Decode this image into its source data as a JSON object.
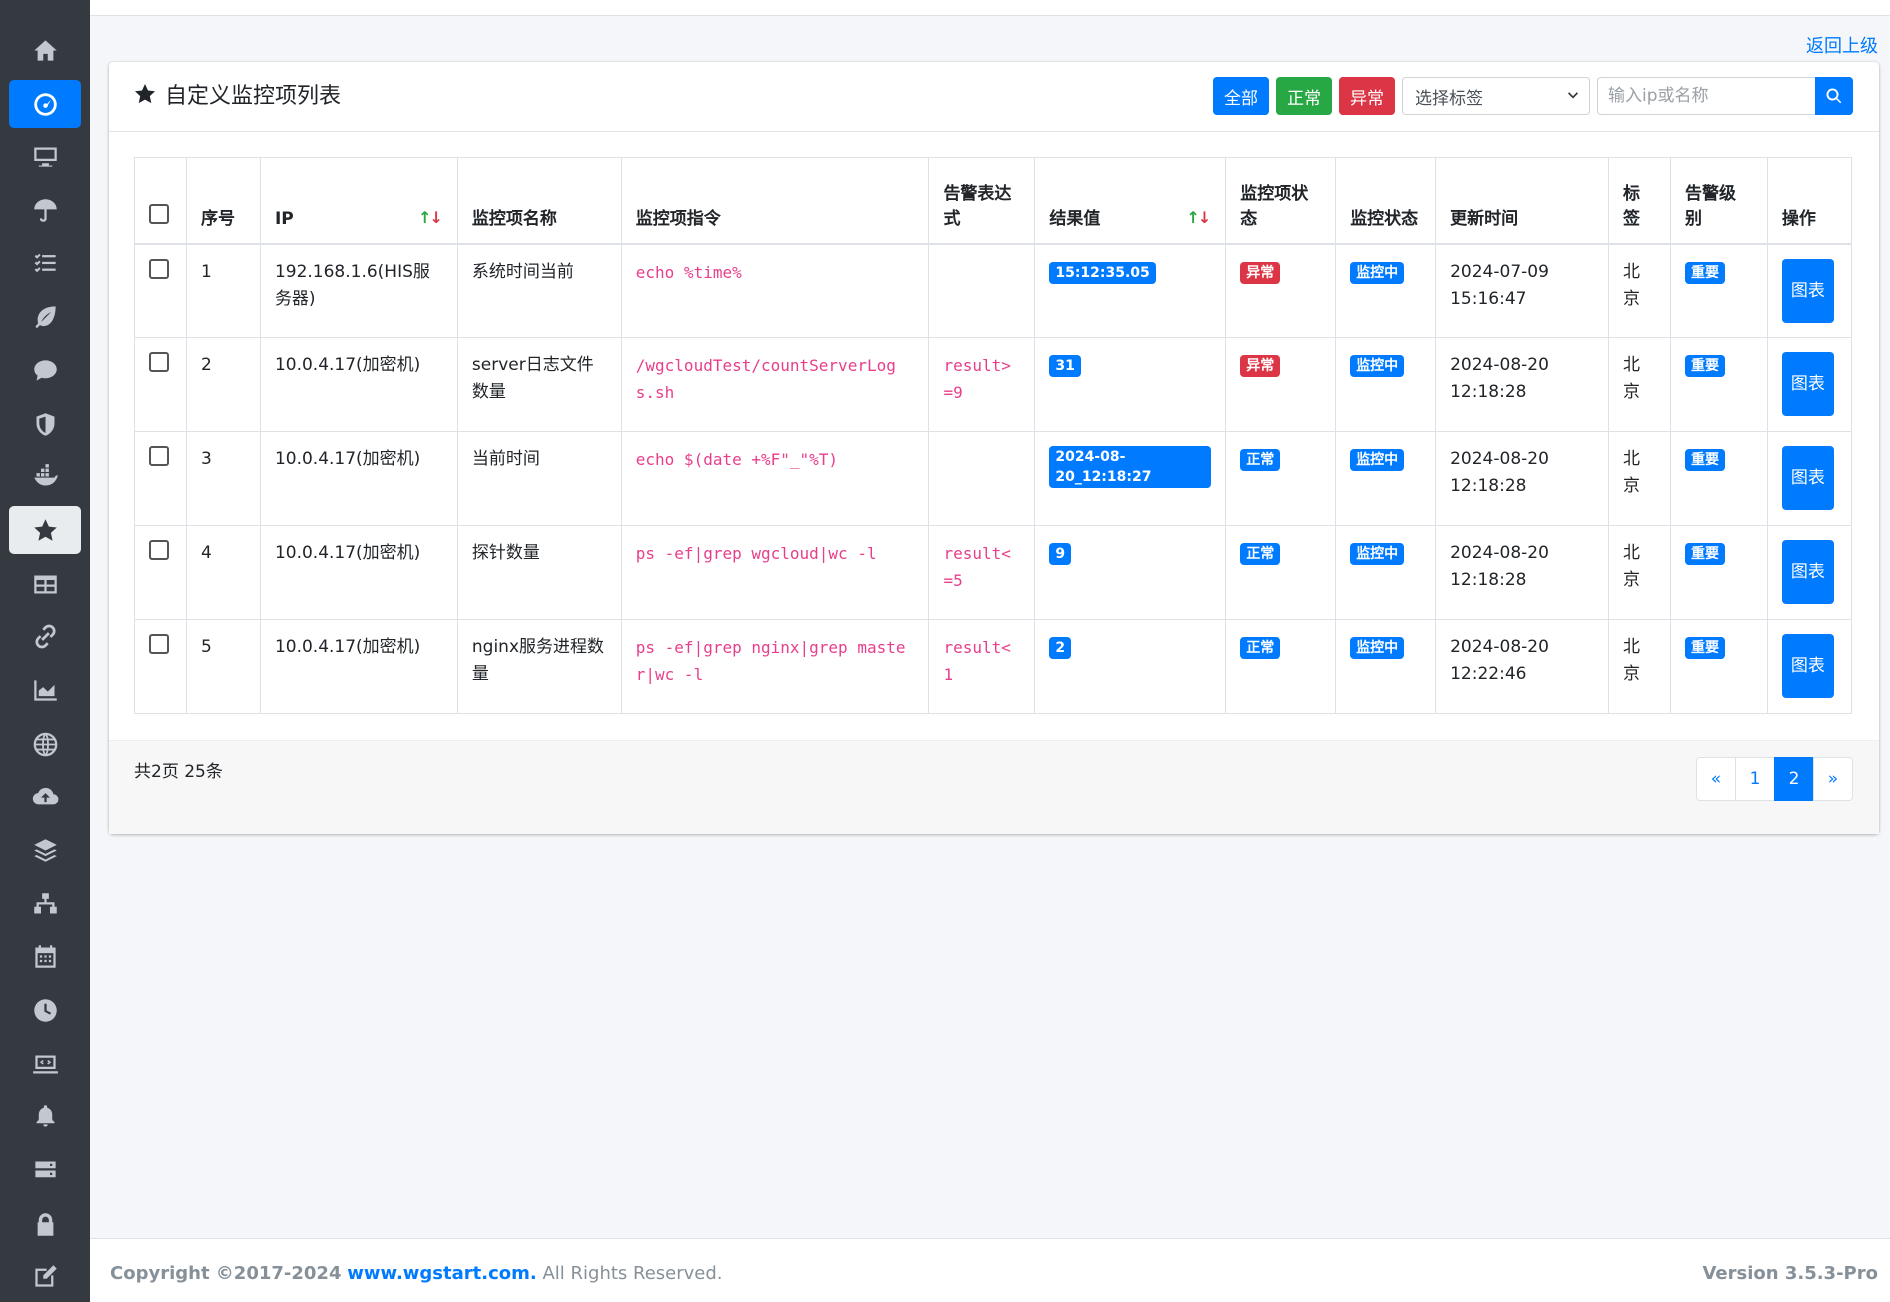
{
  "header": {
    "back_link": "返回上级"
  },
  "sidebar": {
    "items": [
      {
        "icon": "home-icon"
      },
      {
        "icon": "dashboard-icon"
      },
      {
        "icon": "desktop-icon"
      },
      {
        "icon": "umbrella-icon"
      },
      {
        "icon": "task-list-icon"
      },
      {
        "icon": "leaf-icon"
      },
      {
        "icon": "chat-icon"
      },
      {
        "icon": "shield-icon"
      },
      {
        "icon": "docker-icon"
      },
      {
        "icon": "star-icon"
      },
      {
        "icon": "table-icon"
      },
      {
        "icon": "link-icon"
      },
      {
        "icon": "area-chart-icon"
      },
      {
        "icon": "globe-icon"
      },
      {
        "icon": "cloud-upload-icon"
      },
      {
        "icon": "layers-icon"
      },
      {
        "icon": "network-icon"
      },
      {
        "icon": "calendar-icon"
      },
      {
        "icon": "clock-icon"
      },
      {
        "icon": "laptop-code-icon"
      },
      {
        "icon": "bell-icon"
      },
      {
        "icon": "server-icon"
      },
      {
        "icon": "lock-icon"
      },
      {
        "icon": "edit-icon"
      }
    ]
  },
  "card": {
    "title": "自定义监控项列表",
    "buttons": {
      "all": "全部",
      "normal": "正常",
      "abnormal": "异常"
    },
    "select": {
      "value": "选择标签"
    },
    "search": {
      "placeholder": "输入ip或名称"
    }
  },
  "table": {
    "headers": {
      "index": "序号",
      "ip": "IP",
      "name": "监控项名称",
      "cmd": "监控项指令",
      "expr": "告警表达式",
      "result": "结果值",
      "item_status": "监控项状态",
      "monitor_status": "监控状态",
      "updated": "更新时间",
      "tag": "标签",
      "level": "告警级别",
      "action": "操作"
    },
    "sort_up": "↑",
    "sort_down": "↓",
    "rows": [
      {
        "index": "1",
        "ip": "192.168.1.6(HIS服务器)",
        "name": "系统时间当前",
        "cmd": "echo %time%",
        "expr": "",
        "result": "15:12:35.05",
        "item_status": "异常",
        "monitor_status": "监控中",
        "updated": "2024-07-09 15:16:47",
        "tag": "北京",
        "level": "重要",
        "action": "图表"
      },
      {
        "index": "2",
        "ip": "10.0.4.17(加密机)",
        "name": "server日志文件数量",
        "cmd": "/wgcloudTest/countServerLogs.sh",
        "expr": "result>=9",
        "result": "31",
        "item_status": "异常",
        "monitor_status": "监控中",
        "updated": "2024-08-20 12:18:28",
        "tag": "北京",
        "level": "重要",
        "action": "图表"
      },
      {
        "index": "3",
        "ip": "10.0.4.17(加密机)",
        "name": "当前时间",
        "cmd": "echo $(date +%F\"_\"%T)",
        "expr": "",
        "result": "2024-08-20_12:18:27",
        "item_status": "正常",
        "monitor_status": "监控中",
        "updated": "2024-08-20 12:18:28",
        "tag": "北京",
        "level": "重要",
        "action": "图表"
      },
      {
        "index": "4",
        "ip": "10.0.4.17(加密机)",
        "name": "探针数量",
        "cmd": "ps -ef|grep wgcloud|wc -l",
        "expr": "result<=5",
        "result": "9",
        "item_status": "正常",
        "monitor_status": "监控中",
        "updated": "2024-08-20 12:18:28",
        "tag": "北京",
        "level": "重要",
        "action": "图表"
      },
      {
        "index": "5",
        "ip": "10.0.4.17(加密机)",
        "name": "nginx服务进程数量",
        "cmd": "ps -ef|grep nginx|grep master|wc -l",
        "expr": "result<1",
        "result": "2",
        "item_status": "正常",
        "monitor_status": "监控中",
        "updated": "2024-08-20 12:22:46",
        "tag": "北京",
        "level": "重要",
        "action": "图表"
      }
    ]
  },
  "pagination": {
    "summary": "共2页 25条",
    "prev": "«",
    "pages": [
      "1",
      "2"
    ],
    "current": "2",
    "next": "»"
  },
  "footer": {
    "copyright_prefix": "Copyright ©2017-2024",
    "site": "www.wgstart.com.",
    "rights": "All Rights Reserved.",
    "version": "Version 3.5.3-Pro"
  },
  "colors": {
    "sidebar": "#343a40",
    "primary": "#007bff",
    "success": "#28a745",
    "danger": "#dc3545",
    "code": "#e83e8c"
  }
}
